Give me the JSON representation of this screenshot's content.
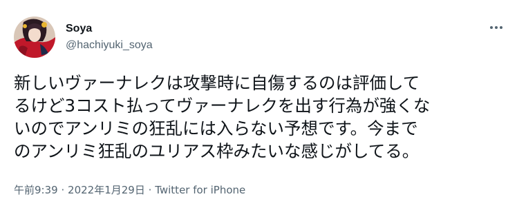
{
  "user": {
    "display_name": "Soya",
    "handle": "@hachiyuki_soya"
  },
  "icons": {
    "more": "more-horizontal-icon"
  },
  "tweet": {
    "lines": [
      "新しいヴァーナレクは攻撃時に自傷するのは評価して",
      "るけど3コスト払ってヴァーナレクを出す行為が強くな",
      "いのでアンリミの狂乱には入らない予想です。今まで",
      "のアンリミ狂乱のユリアス枠みたいな感じがしてる。"
    ]
  },
  "meta": {
    "time": "午前9:39",
    "separator": "·",
    "date": "2022年1月29日",
    "source": "Twitter for iPhone"
  },
  "colors": {
    "text": "#0f1419",
    "secondary": "#536471"
  }
}
